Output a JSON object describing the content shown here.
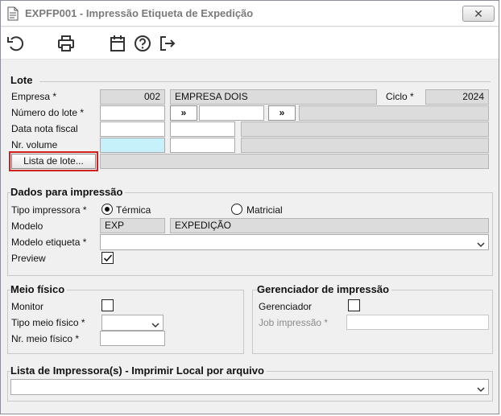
{
  "window": {
    "title": "EXPFP001 - Impressão Etiqueta de Expedição",
    "close_label": "✕"
  },
  "toolbar": {
    "icons": [
      "undo-icon",
      "printer-icon",
      "calendar-icon",
      "help-icon",
      "exit-icon"
    ]
  },
  "lote": {
    "title": "Lote",
    "empresa_label": "Empresa *",
    "empresa_code": "002",
    "empresa_name": "EMPRESA DOIS",
    "ciclo_label": "Ciclo *",
    "ciclo_value": "2024",
    "numero_lote_label": "Número do lote *",
    "arrow_label": "»",
    "data_nota_label": "Data nota fiscal",
    "nr_volume_label": "Nr. volume",
    "lista_lote_button": "Lista de lote..."
  },
  "dados": {
    "title": "Dados para impressão",
    "tipo_impressora_label": "Tipo impressora *",
    "opt_termica": "Térmica",
    "opt_matricial": "Matricial",
    "selected": "Térmica",
    "modelo_label": "Modelo",
    "modelo_code": "EXP",
    "modelo_name": "EXPEDIÇÃO",
    "modelo_etiqueta_label": "Modelo etiqueta *",
    "modelo_etiqueta_value": "",
    "preview_label": "Preview",
    "preview_checked": true
  },
  "meio_fisico": {
    "title": "Meio físico",
    "monitor_label": "Monitor",
    "monitor_checked": false,
    "tipo_label": "Tipo meio físico *",
    "tipo_value": "",
    "nr_label": "Nr. meio físico *",
    "nr_value": ""
  },
  "gerenciador": {
    "title": "Gerenciador de impressão",
    "gerenciador_label": "Gerenciador",
    "gerenciador_checked": false,
    "job_label": "Job impressão *",
    "job_value": ""
  },
  "lista_impressoras": {
    "title": "Lista de Impressora(s) - Imprimir Local por arquivo",
    "value": ""
  }
}
